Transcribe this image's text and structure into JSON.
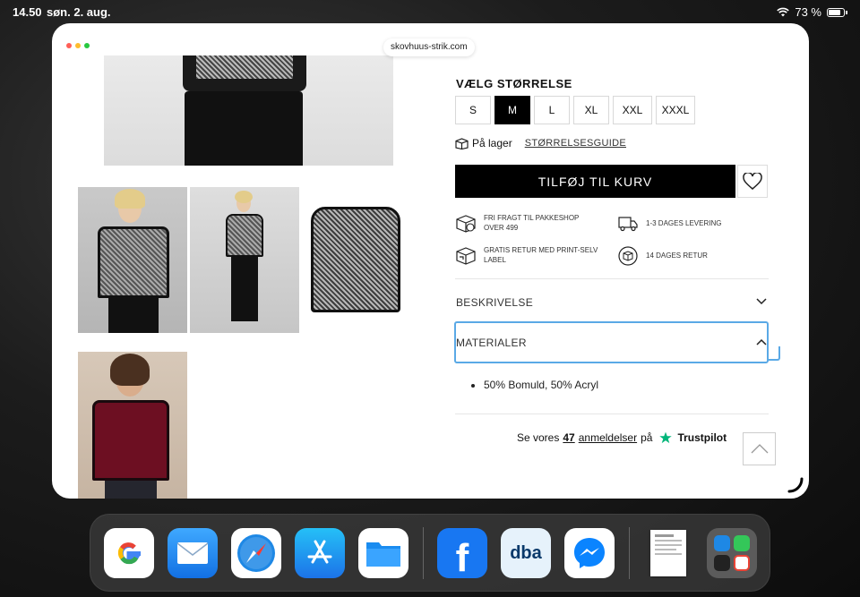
{
  "status_bar": {
    "time": "14.50",
    "date": "søn. 2. aug.",
    "battery": "73 %"
  },
  "browser": {
    "url": "skovhuus-strik.com"
  },
  "product": {
    "size_title": "VÆLG STØRRELSE",
    "sizes": [
      "S",
      "M",
      "L",
      "XL",
      "XXL",
      "XXXL"
    ],
    "selected_size": "M",
    "stock_label": "På lager",
    "size_guide": "STØRRELSESGUIDE",
    "add_to_cart": "TILFØJ TIL KURV",
    "usps": [
      "FRI FRAGT TIL PAKKESHOP OVER 499",
      "1-3 DAGES LEVERING",
      "GRATIS RETUR MED PRINT-SELV LABEL",
      "14 DAGES RETUR"
    ],
    "accordion_description": "BESKRIVELSE",
    "accordion_materials": "MATERIALER",
    "materials": [
      "50% Bomuld, 50% Acryl"
    ],
    "trustpilot": {
      "prefix": "Se vores",
      "count": "47",
      "reviews_word": "anmeldelser",
      "on": "på",
      "brand": "Trustpilot"
    }
  },
  "dock": {
    "apps": [
      "google-icon",
      "mail-icon",
      "safari-icon",
      "app-store-icon",
      "files-icon",
      "facebook-icon",
      "dba-icon",
      "messenger-icon",
      "recent-document-icon",
      "app-library-icon"
    ],
    "dba_label": "dba",
    "facebook_label": "f"
  },
  "colors": {
    "accent_focus": "#5aa9e6",
    "trustpilot_green": "#00b67a",
    "cart_bg": "#000000"
  }
}
